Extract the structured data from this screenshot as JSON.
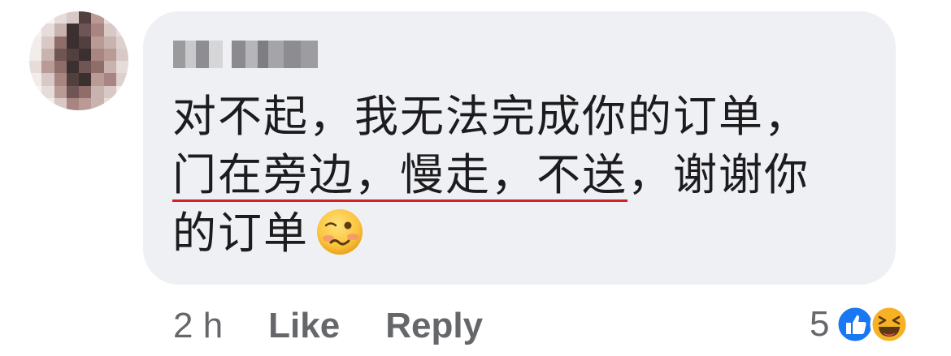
{
  "comment": {
    "author_name": "",
    "lines": [
      "对不起，我无法完成你的订单，",
      [
        "门在旁边，慢走，不送",
        "，谢谢你"
      ],
      "的订单"
    ],
    "emoji": "woozy-face"
  },
  "actions": {
    "time": "2 h",
    "like_label": "Like",
    "reply_label": "Reply"
  },
  "reactions": {
    "count": "5",
    "icons": [
      "like-icon",
      "haha-icon"
    ]
  },
  "colors": {
    "bubble": "#eff0f4",
    "text": "#1c1c1e",
    "meta": "#65676b",
    "underline": "#d0222b",
    "like_blue": "#1877f2",
    "haha_yellow": "#f7b125"
  }
}
